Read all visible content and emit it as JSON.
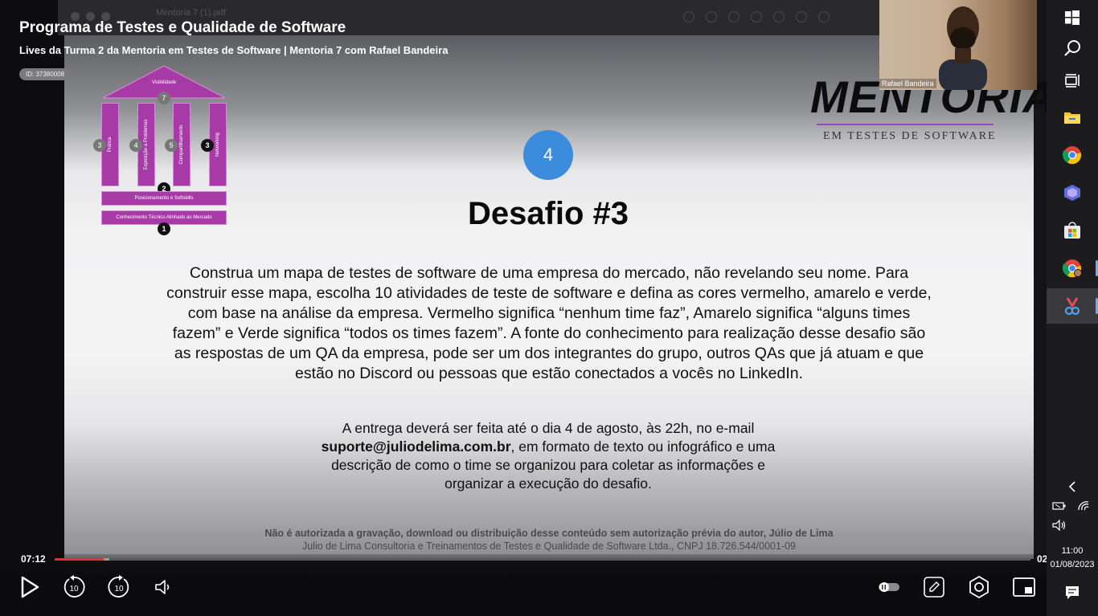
{
  "window": {
    "pdf_doc_name": "Mentoria 7 (1).pdf"
  },
  "video": {
    "title": "Programa de Testes e Qualidade de Software",
    "subtitle": "Lives da Turma 2 da Mentoria em Testes de Software | Mentoria 7 com Rafael Bandeira",
    "id_badge": "ID: 37380008",
    "time_current": "07:12",
    "time_total": "02",
    "progress_fraction": 0.05,
    "buffer_fraction": 0.056,
    "accent_color": "#e0322e"
  },
  "webcam": {
    "name": "Rafael Bandeira"
  },
  "slide": {
    "step_number": "4",
    "step_color": "#3b8cdc",
    "title": "Desafio #3",
    "body_lines": [
      "Construa um mapa de testes de software de uma empresa do mercado, não revelando seu nome. Para",
      "construir esse mapa, escolha 10 atividades de teste de software e defina as cores vermelho, amarelo e verde,",
      "com base na análise da empresa. Vermelho significa “nenhum time faz”, Amarelo significa “alguns times",
      "fazem” e Verde significa “todos os times fazem”. A fonte do conhecimento para realização desse desafio são",
      "as respostas de um QA da empresa, pode ser um dos integrantes do grupo, outros QAs que já atuam e que",
      "estão no Discord ou pessoas que estão conectados a vocês no LinkedIn."
    ],
    "delivery_line1": "A entrega deverá ser feita até o dia 4 de agosto, às 22h, no e-mail",
    "delivery_email": "suporte@juliodelima.com.br",
    "delivery_line2_rest": ", em formato de texto ou infográfico e uma",
    "delivery_line3": "descrição de como o time se organizou para coletar as informações e",
    "delivery_line4": "organizar a execução do desafio.",
    "footer_bold": "Não é autorizada a gravação, download ou distribuição desse conteúdo sem autorização prévia do autor, Júlio de Lima",
    "footer_regular": "Julio de Lima Consultoria e Treinamentos de Testes e Qualidade de Software Ltda., CNPJ 18.726.544/0001-09"
  },
  "temple": {
    "roof_label": "Visibilidade",
    "roof_number": "7",
    "pillars": [
      {
        "label": "Prática",
        "number": "3"
      },
      {
        "label": "Exposição a Problemas",
        "number": "4"
      },
      {
        "label": "Compartilhamento",
        "number": "5"
      },
      {
        "label": "Networking",
        "number": "3"
      }
    ],
    "bar_top_label": "Posicionamento e Softskills",
    "bar_top_number": "2",
    "bar_bottom_label": "Conhecimento Técnico Alinhado ao Mercado",
    "bar_bottom_number": "1",
    "color": "#a83aa8"
  },
  "logo": {
    "brand": "MENTORIA",
    "tagline": "EM TESTES DE SOFTWARE"
  },
  "controls": {
    "rewind_seconds": "10",
    "forward_seconds": "10"
  },
  "taskbar": {
    "icons": [
      "windows-start-icon",
      "search-icon",
      "task-view-icon",
      "file-explorer-icon",
      "chrome-icon",
      "copilot-icon",
      "microsoft-store-icon",
      "chrome-profile-icon",
      "snipping-tool-icon"
    ],
    "time": "11:00",
    "date": "01/08/2023"
  }
}
